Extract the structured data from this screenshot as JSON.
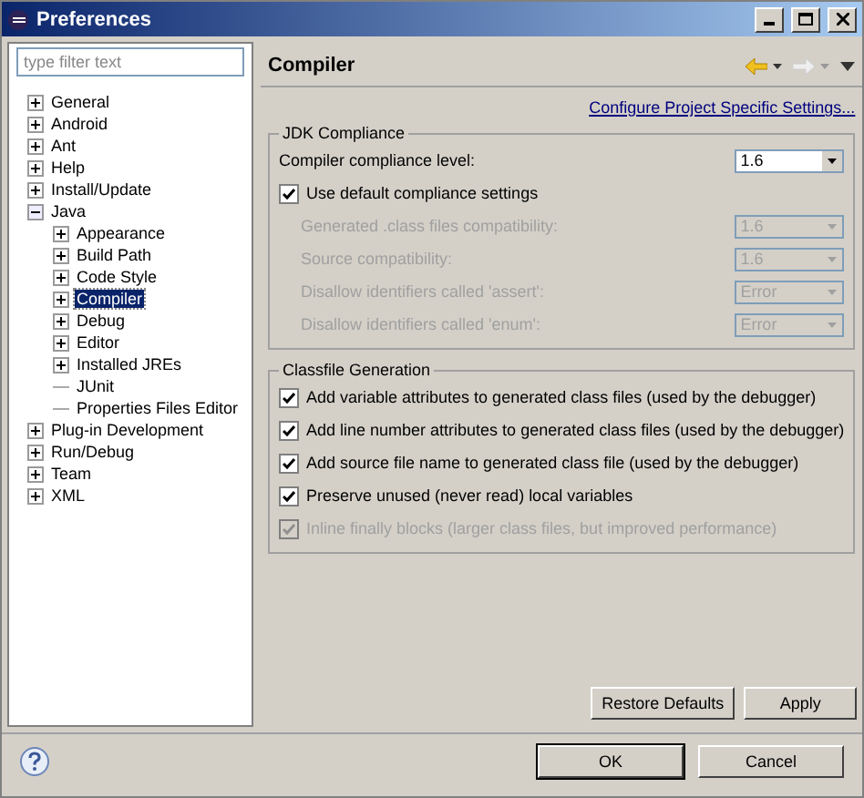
{
  "window": {
    "title": "Preferences"
  },
  "filter": {
    "placeholder": "type filter text"
  },
  "tree": [
    {
      "label": "General",
      "kind": "folder",
      "expanded": false,
      "selected": false
    },
    {
      "label": "Android",
      "kind": "folder",
      "expanded": false,
      "selected": false
    },
    {
      "label": "Ant",
      "kind": "folder",
      "expanded": false,
      "selected": false
    },
    {
      "label": "Help",
      "kind": "folder",
      "expanded": false,
      "selected": false
    },
    {
      "label": "Install/Update",
      "kind": "folder",
      "expanded": false,
      "selected": false
    },
    {
      "label": "Java",
      "kind": "folder",
      "expanded": true,
      "selected": false,
      "children": [
        {
          "label": "Appearance",
          "kind": "folder",
          "expanded": false,
          "selected": false
        },
        {
          "label": "Build Path",
          "kind": "folder",
          "expanded": false,
          "selected": false
        },
        {
          "label": "Code Style",
          "kind": "folder",
          "expanded": false,
          "selected": false
        },
        {
          "label": "Compiler",
          "kind": "folder",
          "expanded": false,
          "selected": true
        },
        {
          "label": "Debug",
          "kind": "folder",
          "expanded": false,
          "selected": false
        },
        {
          "label": "Editor",
          "kind": "folder",
          "expanded": false,
          "selected": false
        },
        {
          "label": "Installed JREs",
          "kind": "folder",
          "expanded": false,
          "selected": false
        },
        {
          "label": "JUnit",
          "kind": "leaf",
          "selected": false
        },
        {
          "label": "Properties Files Editor",
          "kind": "leaf",
          "selected": false
        }
      ]
    },
    {
      "label": "Plug-in Development",
      "kind": "folder",
      "expanded": false,
      "selected": false
    },
    {
      "label": "Run/Debug",
      "kind": "folder",
      "expanded": false,
      "selected": false
    },
    {
      "label": "Team",
      "kind": "folder",
      "expanded": false,
      "selected": false
    },
    {
      "label": "XML",
      "kind": "folder",
      "expanded": false,
      "selected": false
    }
  ],
  "page": {
    "title": "Compiler",
    "link": "Configure Project Specific Settings..."
  },
  "jdk": {
    "title": "JDK Compliance",
    "rows": [
      {
        "kind": "select",
        "label": "Compiler compliance level:",
        "value": "1.6",
        "disabled": false
      },
      {
        "kind": "checkbox",
        "label": "Use default compliance settings",
        "checked": true,
        "disabled": false
      },
      {
        "kind": "select",
        "label": "Generated .class files compatibility:",
        "value": "1.6",
        "disabled": true
      },
      {
        "kind": "select",
        "label": "Source compatibility:",
        "value": "1.6",
        "disabled": true
      },
      {
        "kind": "select",
        "label": "Disallow identifiers called 'assert':",
        "value": "Error",
        "disabled": true
      },
      {
        "kind": "select",
        "label": "Disallow identifiers called 'enum':",
        "value": "Error",
        "disabled": true
      }
    ]
  },
  "classfile": {
    "title": "Classfile Generation",
    "options": [
      {
        "label": "Add variable attributes to generated class files (used by the debugger)",
        "checked": true,
        "disabled": false
      },
      {
        "label": "Add line number attributes to generated class files (used by the debugger)",
        "checked": true,
        "disabled": false
      },
      {
        "label": "Add source file name to generated class file (used by the debugger)",
        "checked": true,
        "disabled": false
      },
      {
        "label": "Preserve unused (never read) local variables",
        "checked": true,
        "disabled": false
      },
      {
        "label": "Inline finally blocks (larger class files, but improved performance)",
        "checked": true,
        "disabled": true
      }
    ]
  },
  "page_buttons": [
    "Restore Defaults",
    "Apply"
  ],
  "dialog_buttons": [
    {
      "label": "OK",
      "default": true
    },
    {
      "label": "Cancel",
      "default": false
    }
  ]
}
